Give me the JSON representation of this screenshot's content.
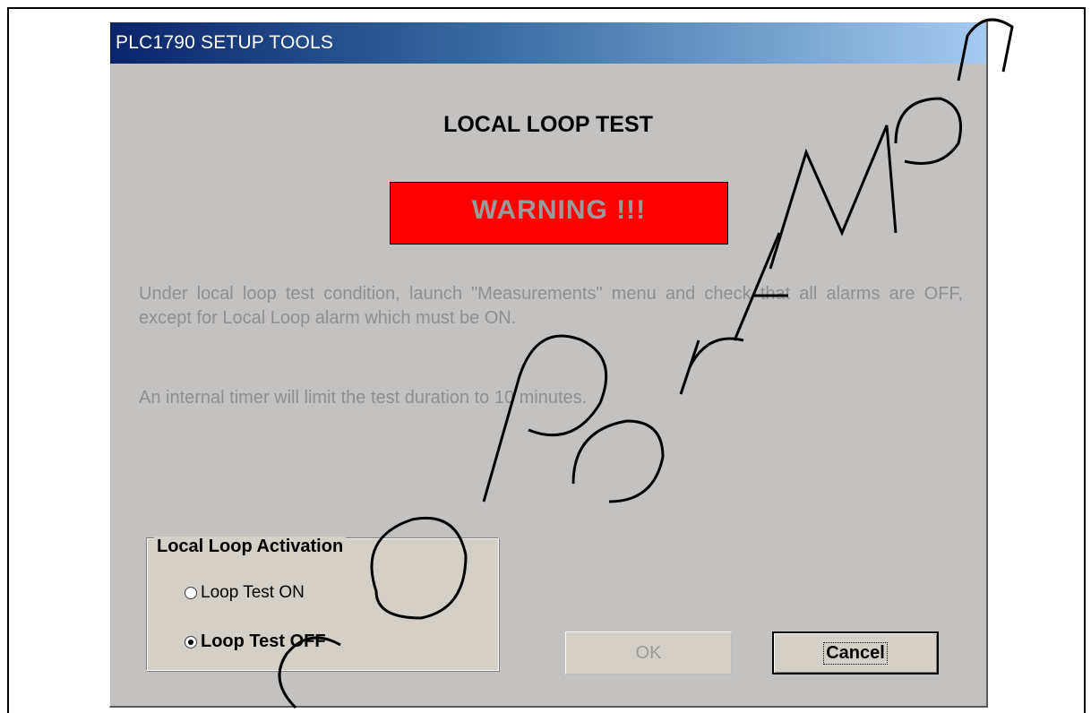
{
  "window": {
    "title": "PLC1790 SETUP TOOLS"
  },
  "dialog": {
    "heading": "LOCAL LOOP TEST",
    "warning": "WARNING !!!",
    "message_1": "Under local loop test condition, launch \"Measurements\" menu and check that all alarms are OFF, except for Local Loop alarm which must be ON.",
    "message_2": "An internal timer will limit the test duration to 10 minutes."
  },
  "activation_group": {
    "title": "Local Loop Activation",
    "options": [
      {
        "label": "Loop Test ON",
        "selected": false
      },
      {
        "label": "Loop Test OFF",
        "selected": true
      }
    ]
  },
  "buttons": {
    "ok_label": "OK",
    "ok_enabled": false,
    "cancel_label": "Cancel"
  },
  "colors": {
    "warning_bg": "#ff0000",
    "title_gradient_start": "#0a246a",
    "title_gradient_end": "#a6caf0",
    "dialog_bg": "#c4c1c1"
  }
}
